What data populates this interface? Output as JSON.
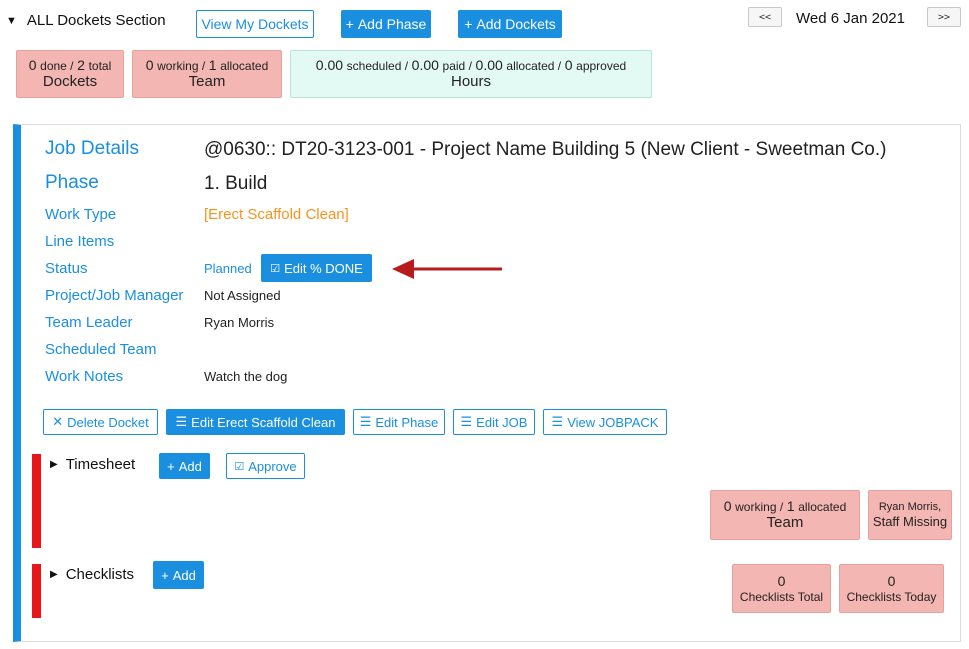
{
  "header": {
    "section_title": "ALL Dockets Section",
    "view_my_dockets": "View My Dockets",
    "add_phase": "Add Phase",
    "add_dockets": "Add Dockets",
    "prev": "<<",
    "next": ">>",
    "date": "Wed 6 Jan 2021"
  },
  "summary": {
    "dockets": {
      "done": "0",
      "done_label": "done /",
      "total": "2",
      "total_label": "total",
      "label": "Dockets"
    },
    "team": {
      "working": "0",
      "working_label": "working /",
      "allocated": "1",
      "allocated_label": "allocated",
      "label": "Team"
    },
    "hours": {
      "scheduled": "0.00",
      "scheduled_label": "scheduled /",
      "paid": "0.00",
      "paid_label": "paid /",
      "allocated": "0.00",
      "allocated_label": "allocated /",
      "approved": "0",
      "approved_label": "approved",
      "label": "Hours"
    }
  },
  "job": {
    "labels": {
      "job_details": "Job Details",
      "phase": "Phase",
      "work_type": "Work Type",
      "line_items": "Line Items",
      "status": "Status",
      "manager": "Project/Job Manager",
      "team_leader": "Team Leader",
      "scheduled_team": "Scheduled Team",
      "work_notes": "Work Notes"
    },
    "values": {
      "job_details": "@0630:: DT20-3123-001 - Project Name Building 5 (New Client - Sweetman Co.)",
      "phase": "1. Build",
      "work_type": "[Erect Scaffold Clean]",
      "status": "Planned",
      "edit_done": "Edit % DONE",
      "manager": "Not Assigned",
      "team_leader": "Ryan Morris",
      "work_notes": "Watch the dog"
    },
    "actions": {
      "delete_docket": "Delete Docket",
      "edit_work_type": "Edit Erect Scaffold Clean",
      "edit_phase": "Edit Phase",
      "edit_job": "Edit JOB",
      "view_jobpack": "View JOBPACK"
    }
  },
  "timesheet": {
    "title": "Timesheet",
    "add": "Add",
    "approve": "Approve",
    "team_stat": {
      "working": "0",
      "working_label": "working /",
      "allocated": "1",
      "allocated_label": "allocated",
      "label": "Team"
    },
    "missing": {
      "name": "Ryan Morris,",
      "label": "Staff Missing"
    }
  },
  "checklists": {
    "title": "Checklists",
    "add": "Add",
    "total": {
      "value": "0",
      "label": "Checklists Total"
    },
    "today": {
      "value": "0",
      "label": "Checklists Today"
    }
  },
  "colors": {
    "accent": "#1a8fe0",
    "warning": "#f7941d",
    "stat_red": "#f4b6b2",
    "stat_green": "#e3faf4",
    "alert_bar": "#e8151b",
    "arrow": "#b71c1c"
  }
}
